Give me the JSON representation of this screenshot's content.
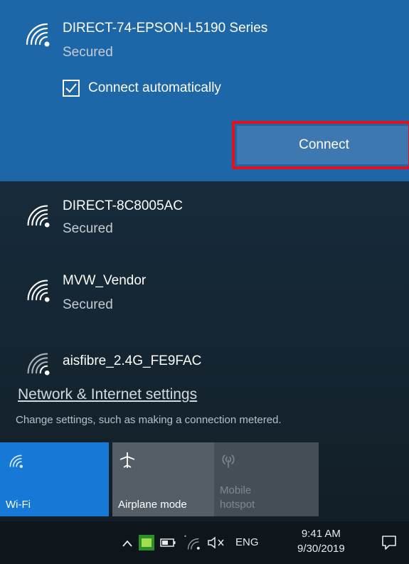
{
  "selected_network": {
    "name": "DIRECT-74-EPSON-L5190 Series",
    "status": "Secured",
    "auto_connect_label": "Connect automatically",
    "auto_connect_checked": true,
    "connect_button_label": "Connect",
    "highlight_color": "#e5101c"
  },
  "networks": [
    {
      "name": "DIRECT-8C8005AC",
      "status": "Secured"
    },
    {
      "name": "MVW_Vendor",
      "status": "Secured"
    },
    {
      "name": "aisfibre_2.4G_FE9FAC",
      "status": ""
    }
  ],
  "settings": {
    "link_label": "Network & Internet settings",
    "description": "Change settings, such as making a connection metered."
  },
  "quick_actions": [
    {
      "label": "Wi-Fi",
      "icon": "wifi-icon",
      "active": true
    },
    {
      "label": "Airplane mode",
      "icon": "airplane-icon",
      "active": false
    },
    {
      "label": "Mobile\nhotspot",
      "icon": "hotspot-icon",
      "active": false,
      "disabled": true
    }
  ],
  "taskbar": {
    "language": "ENG",
    "time": "9:41 AM",
    "date": "9/30/2019",
    "icons": [
      "chevron-up-icon",
      "app-tray-icon",
      "battery-icon",
      "wifi-tray-icon",
      "volume-muted-icon",
      "notification-icon"
    ]
  },
  "colors": {
    "selected_bg": "#1d67a8",
    "connect_button": "#3d79b0",
    "wifi_tile": "#1779d6",
    "airplane_tile": "#535e67",
    "hotspot_tile": "#454e56"
  }
}
